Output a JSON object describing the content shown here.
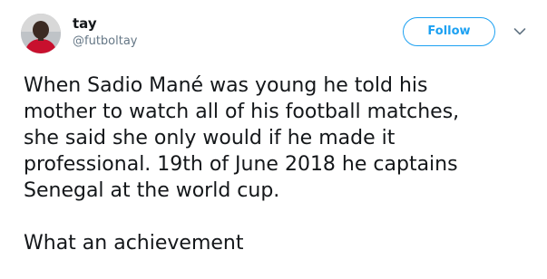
{
  "user": {
    "display_name": "tay",
    "handle": "@futboltay",
    "avatar_icon": "profile-photo"
  },
  "actions": {
    "follow_label": "Follow",
    "menu_icon": "chevron-down-icon"
  },
  "tweet": {
    "lines": [
      "When Sadio Mané was young he told his",
      "mother to watch all of his football matches,",
      "she said she only would if he made it",
      "professional. 19th of June 2018 he captains",
      "Senegal at the world cup."
    ],
    "closing": "What an achievement"
  },
  "colors": {
    "accent": "#1da1f2",
    "text": "#14171a",
    "muted": "#657786"
  }
}
